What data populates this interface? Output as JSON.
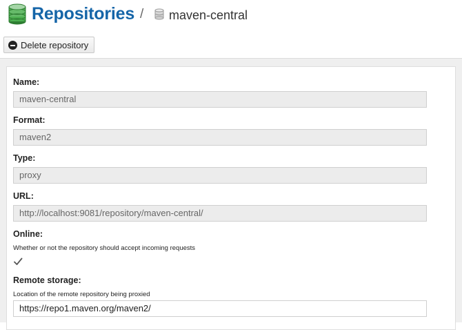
{
  "header": {
    "title": "Repositories",
    "separator": "/",
    "repo_name": "maven-central"
  },
  "toolbar": {
    "delete_label": "Delete repository"
  },
  "form": {
    "name": {
      "label": "Name:",
      "value": "maven-central"
    },
    "format": {
      "label": "Format:",
      "value": "maven2"
    },
    "type": {
      "label": "Type:",
      "value": "proxy"
    },
    "url": {
      "label": "URL:",
      "value": "http://localhost:9081/repository/maven-central/"
    },
    "online": {
      "label": "Online:",
      "help": "Whether or not the repository should accept incoming requests",
      "checked": true
    },
    "remote_storage": {
      "label": "Remote storage:",
      "help": "Location of the remote repository being proxied",
      "value": "https://repo1.maven.org/maven2/"
    }
  },
  "colors": {
    "accent": "#1565a8",
    "db_icon": "#4caf50"
  },
  "icons": [
    "database-icon",
    "database-small-icon",
    "minus-circle-icon",
    "checkmark-icon"
  ]
}
